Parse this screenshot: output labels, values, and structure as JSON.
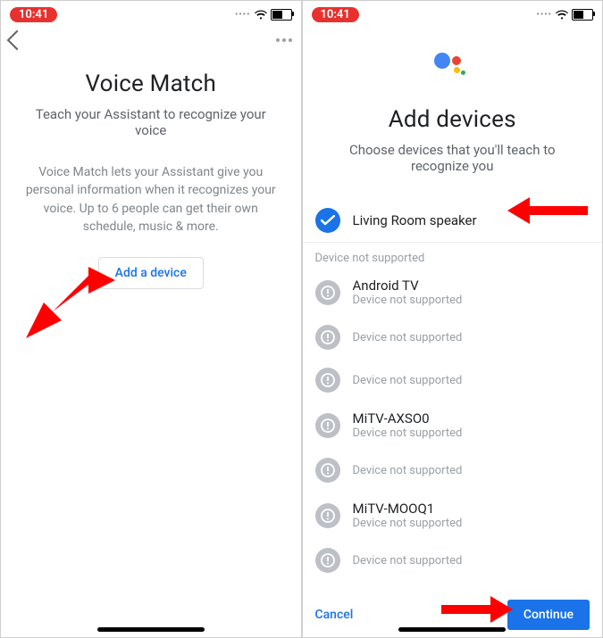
{
  "status": {
    "time": "10:41"
  },
  "left": {
    "title": "Voice Match",
    "subtitle": "Teach your Assistant to recognize your voice",
    "description": "Voice Match lets your Assistant give you personal information when it recognizes your voice. Up to 6 people can get their own schedule, music & more.",
    "add_device": "Add a device"
  },
  "right": {
    "title": "Add devices",
    "subtitle": "Choose devices that you'll teach to recognize you",
    "selected_device": "Living Room speaker",
    "unsupported_label": "Device not supported",
    "devices": [
      {
        "name": "Android TV",
        "sub": "Device not supported"
      },
      {
        "name": "",
        "sub": "Device not supported"
      },
      {
        "name": "",
        "sub": "Device not supported"
      },
      {
        "name": "MiTV-AXSO0",
        "sub": "Device not supported"
      },
      {
        "name": "",
        "sub": "Device not supported"
      },
      {
        "name": "MiTV-MOOQ1",
        "sub": "Device not supported"
      },
      {
        "name": "",
        "sub": "Device not supported"
      }
    ],
    "cancel": "Cancel",
    "continue": "Continue"
  }
}
